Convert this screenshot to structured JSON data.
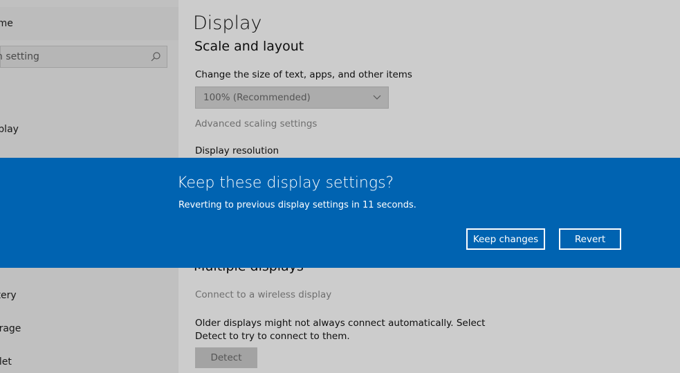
{
  "sidebar": {
    "home_label": "ome",
    "search_placeholder": "n setting",
    "items": [
      {
        "label": "splay"
      },
      {
        "label": "ttery"
      },
      {
        "label": "orage"
      },
      {
        "label": "blet"
      }
    ]
  },
  "main": {
    "title": "Display",
    "section_scale": "Scale and layout",
    "scale_label": "Change the size of text, apps, and other items",
    "scale_value": "100% (Recommended)",
    "advanced_link": "Advanced scaling settings",
    "resolution_label": "Display resolution",
    "section_multiple": "Multiple displays",
    "wireless_link": "Connect to a wireless display",
    "older_text": "Older displays might not always connect automatically. Select Detect to try to connect to them.",
    "detect_label": "Detect"
  },
  "dialog": {
    "title": "Keep these display settings?",
    "message": "Reverting to previous display settings in 11 seconds.",
    "keep_label": "Keep changes",
    "revert_label": "Revert"
  },
  "colors": {
    "dialog_bg": "#0063b1",
    "sidebar_bg": "#f0f0f0"
  }
}
